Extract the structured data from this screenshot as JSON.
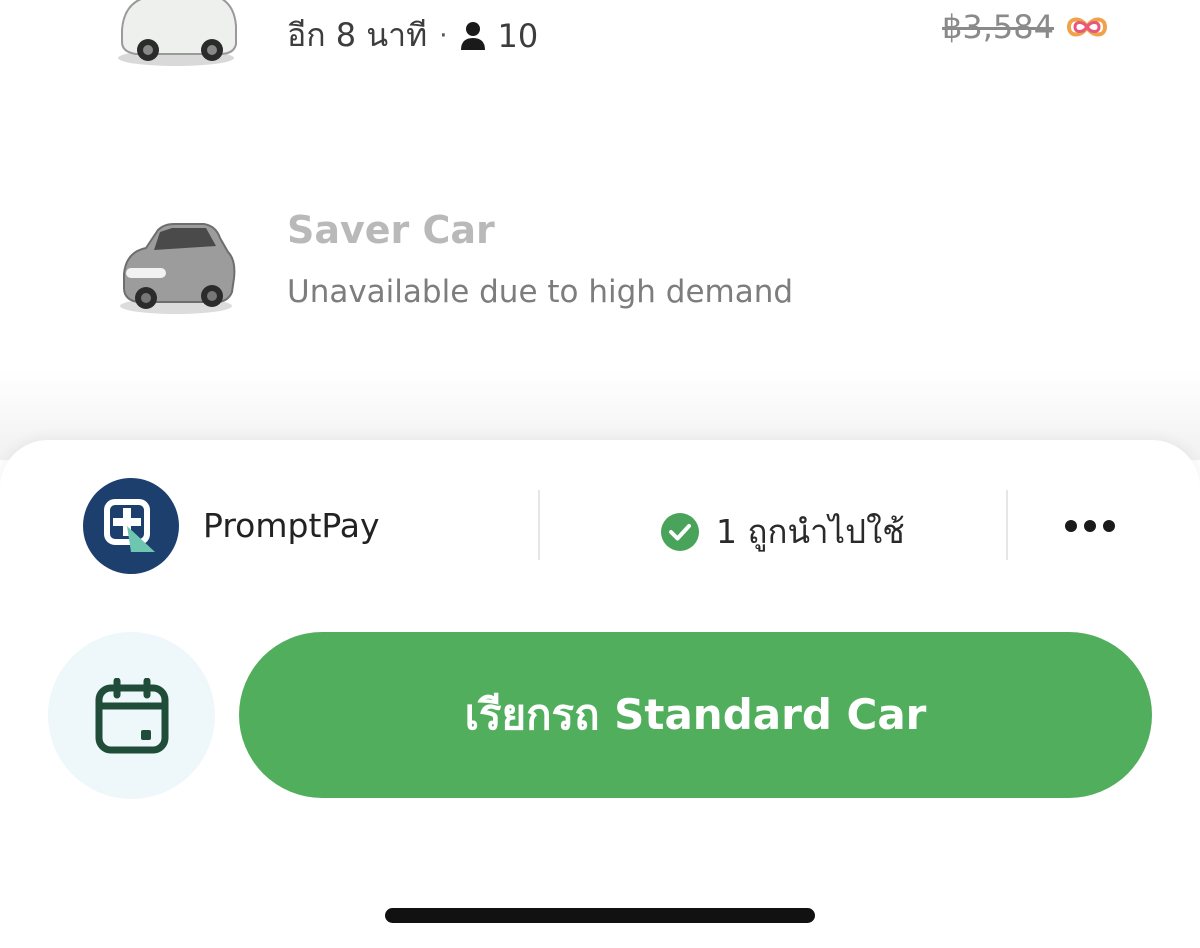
{
  "top_ride": {
    "eta_text": "อีก 8 นาที",
    "separator": "·",
    "seats": "10",
    "price_old": "฿3,584",
    "icons": {
      "car": "green-car-icon",
      "person": "person-icon",
      "promo": "promo-loop-icon"
    }
  },
  "saver_ride": {
    "title": "Saver Car",
    "subtitle": "Unavailable due to high demand",
    "icons": {
      "car": "grey-car-icon"
    }
  },
  "payment": {
    "method_label": "PromptPay",
    "promo_text": "1 ถูกนำไปใช้",
    "icons": {
      "logo": "promptpay-logo",
      "check": "check-circle-icon",
      "more": "more-dots-icon"
    }
  },
  "actions": {
    "book_label": "เรียกรถ Standard Car",
    "schedule_icon": "calendar-icon"
  },
  "colors": {
    "primary_green": "#51ae5c",
    "check_green": "#4aa35a",
    "promptpay_navy": "#1d3f6e",
    "schedule_bg": "#eef7fa",
    "calendar_green": "#1f4d3a"
  }
}
